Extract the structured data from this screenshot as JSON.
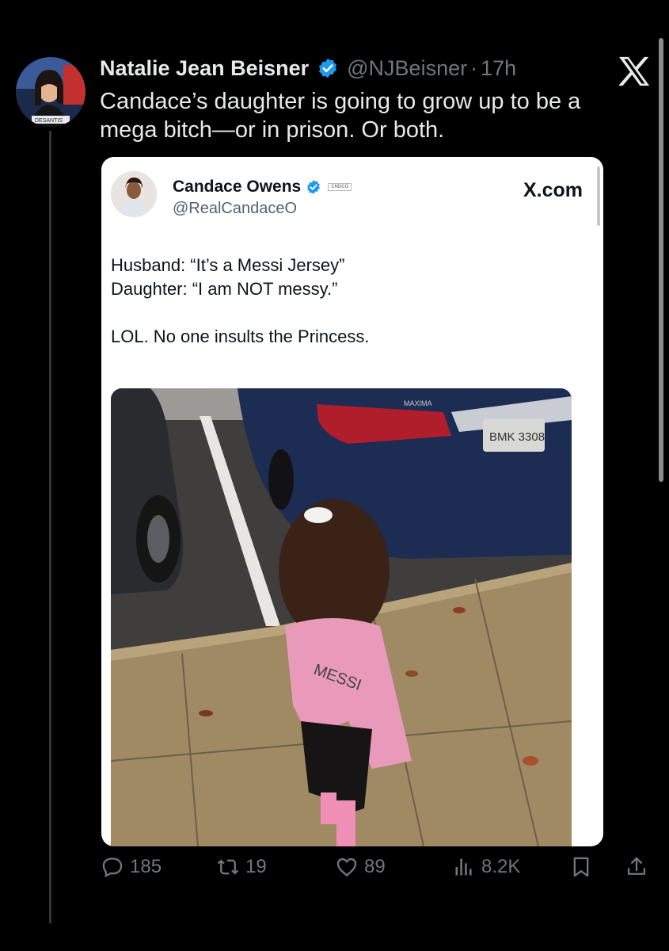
{
  "post": {
    "author_name": "Natalie Jean Beisner",
    "handle": "@NJBeisner",
    "separator": "·",
    "time": "17h",
    "text": "Candace’s daughter is going to grow up to be a mega bitch—or in prison. Or both.",
    "avatar_label": "DESANTIS"
  },
  "quoted": {
    "author_name": "Candace Owens",
    "handle": "@RealCandaceO",
    "badge": "CNDCO",
    "site": "X.com",
    "lines": [
      "Husband: “It’s a Messi Jersey”",
      "Daughter:  “I am NOT messy.”",
      "",
      "LOL. No one insults the Princess."
    ],
    "photo": {
      "plate": "BMK 3308",
      "car_model": "MAXIMA",
      "jersey_text": "MESSI"
    }
  },
  "actions": {
    "replies": "185",
    "reposts": "19",
    "likes": "89",
    "views": "8.2K"
  },
  "icons": [
    "x-logo-icon",
    "verified-icon",
    "reply-icon",
    "repost-icon",
    "like-icon",
    "views-icon",
    "bookmark-icon",
    "share-icon"
  ],
  "colors": {
    "background": "#000000",
    "verified": "#1d9bf0",
    "muted": "#71767b"
  }
}
